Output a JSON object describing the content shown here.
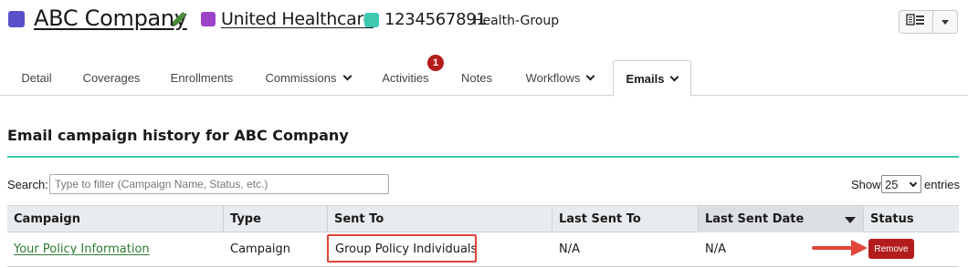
{
  "header": {
    "company_name": "ABC Company",
    "carrier_name": "United Healthcare",
    "group_number": "1234567891",
    "group_type": "Health-Group",
    "icons": [
      "pencil-icon",
      "document-list-icon",
      "caret-down-icon"
    ]
  },
  "tabs": [
    {
      "label": "Detail"
    },
    {
      "label": "Coverages"
    },
    {
      "label": "Enrollments"
    },
    {
      "label": "Commissions"
    },
    {
      "label": "Activities",
      "badge": "1"
    },
    {
      "label": "Notes"
    },
    {
      "label": "Workflows"
    },
    {
      "label": "Emails"
    }
  ],
  "section": {
    "title": "Email campaign history for ABC Company"
  },
  "filter": {
    "search_label": "Search:",
    "search_placeholder": "Type to filter (Campaign Name, Status, etc.)",
    "show_label": "Show",
    "entries_value": "25",
    "entries_label": "entries"
  },
  "table": {
    "headers": [
      "Campaign",
      "Type",
      "Sent To",
      "Last Sent To",
      "Last Sent Date",
      "Status"
    ],
    "sorted_column": "Last Sent Date",
    "rows": [
      {
        "campaign": "Your Policy Information",
        "type": "Campaign",
        "sent_to": "Group Policy Individuals",
        "last_sent_to": "N/A",
        "last_sent_date": "N/A",
        "status_action": "Remove"
      }
    ]
  },
  "colors": {
    "company": "#5a4fc8",
    "carrier": "#9b42c8",
    "group": "#3cc9b0",
    "accent_rule": "#3cc9b0",
    "remove_button": "#b31c1c",
    "highlight": "#e0443a",
    "link": "#2e7d32"
  }
}
